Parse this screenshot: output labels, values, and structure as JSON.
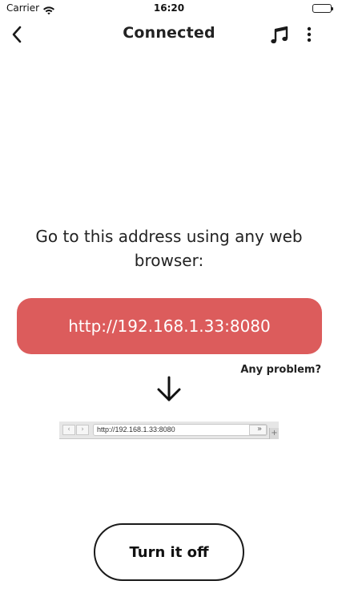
{
  "status_bar": {
    "carrier": "Carrier",
    "time": "16:20"
  },
  "nav": {
    "title": "Connected",
    "back_icon": "chevron-left-icon",
    "music_icon": "music-note-icon",
    "more_icon": "more-vertical-icon"
  },
  "main": {
    "instruction": "Go to this address using any web browser:",
    "url": "http://192.168.1.33:8080",
    "problem_link": "Any problem?",
    "turn_off_label": "Turn it off"
  },
  "browser_illustration": {
    "back_glyph": "‹",
    "forward_glyph": "›",
    "url": "http://192.168.1.33:8080",
    "overflow_glyph": "»",
    "plus_glyph": "+"
  },
  "colors": {
    "accent": "#dc5c5c",
    "text": "#1f1f1f",
    "background": "#ffffff"
  }
}
